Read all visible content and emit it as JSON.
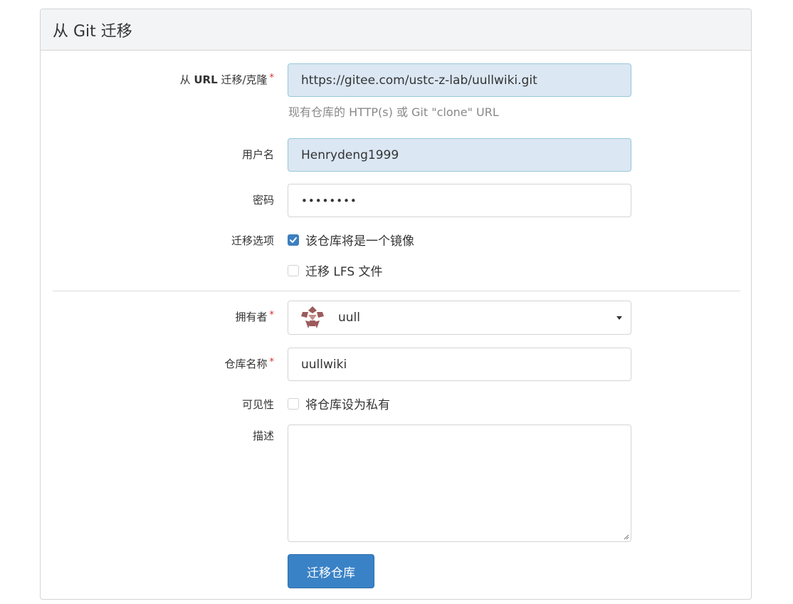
{
  "panel": {
    "title": "从 Git 迁移"
  },
  "clone_url": {
    "label_prefix": "从 ",
    "label_bold": "URL",
    "label_suffix": " 迁移/克隆",
    "required_mark": "*",
    "value": "https://gitee.com/ustc-z-lab/uullwiki.git",
    "hint": "现有仓库的 HTTP(s) 或 Git \"clone\" URL"
  },
  "username": {
    "label": "用户名",
    "value": "Henrydeng1999"
  },
  "password": {
    "label": "密码",
    "value": "••••••••"
  },
  "migrate_options": {
    "label": "迁移选项",
    "mirror": {
      "label": "该仓库将是一个镜像",
      "checked": true
    },
    "lfs": {
      "label": "迁移 LFS 文件",
      "checked": false
    }
  },
  "owner": {
    "label": "拥有者",
    "required_mark": "*",
    "value": "uull",
    "icon": "owner-avatar-icon"
  },
  "repo_name": {
    "label": "仓库名称",
    "required_mark": "*",
    "value": "uullwiki"
  },
  "visibility": {
    "label": "可见性",
    "private": {
      "label": "将仓库设为私有",
      "checked": false
    }
  },
  "description": {
    "label": "描述",
    "value": ""
  },
  "submit": {
    "label": "迁移仓库"
  },
  "colors": {
    "accent": "#3a82c6",
    "required": "#db2828",
    "autofill": "#dbe7f3"
  }
}
